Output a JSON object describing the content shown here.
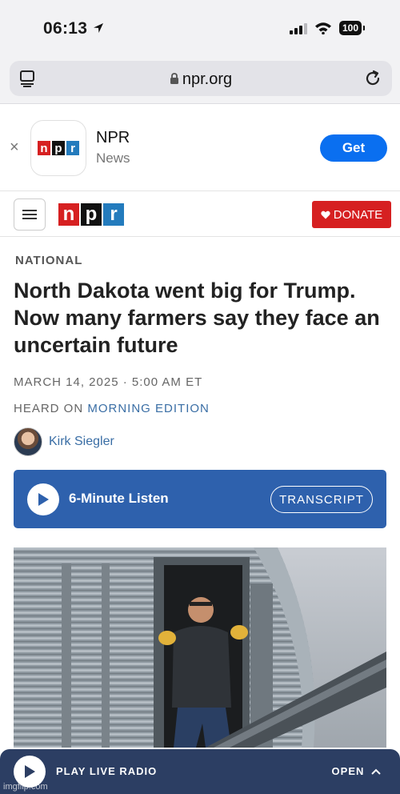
{
  "status_bar": {
    "time": "06:13",
    "battery": "100"
  },
  "browser": {
    "url": "npr.org"
  },
  "app_banner": {
    "close": "×",
    "app_name": "NPR",
    "app_subtitle": "News",
    "get_label": "Get"
  },
  "logo": {
    "letters": [
      "n",
      "p",
      "r"
    ]
  },
  "header": {
    "donate_label": "DONATE"
  },
  "article": {
    "section": "NATIONAL",
    "headline": "North Dakota went big for Trump. Now many farmers say they face an uncertain future",
    "dateline": "MARCH 14, 2025 · 5:00 AM ET",
    "heard_on_prefix": "HEARD ON",
    "heard_on_show": "MORNING EDITION",
    "author": "Kirk Siegler"
  },
  "listen": {
    "label": "6-Minute Listen",
    "transcript_label": "TRANSCRIPT"
  },
  "live_radio": {
    "label": "PLAY LIVE RADIO",
    "open_label": "OPEN"
  },
  "watermark": "imgflip.com",
  "colors": {
    "npr_red": "#d62021",
    "npr_blue": "#237bbd",
    "listen_blue": "#2e61ad",
    "live_bar": "#2c3e63",
    "get_blue": "#0a6ff0"
  }
}
